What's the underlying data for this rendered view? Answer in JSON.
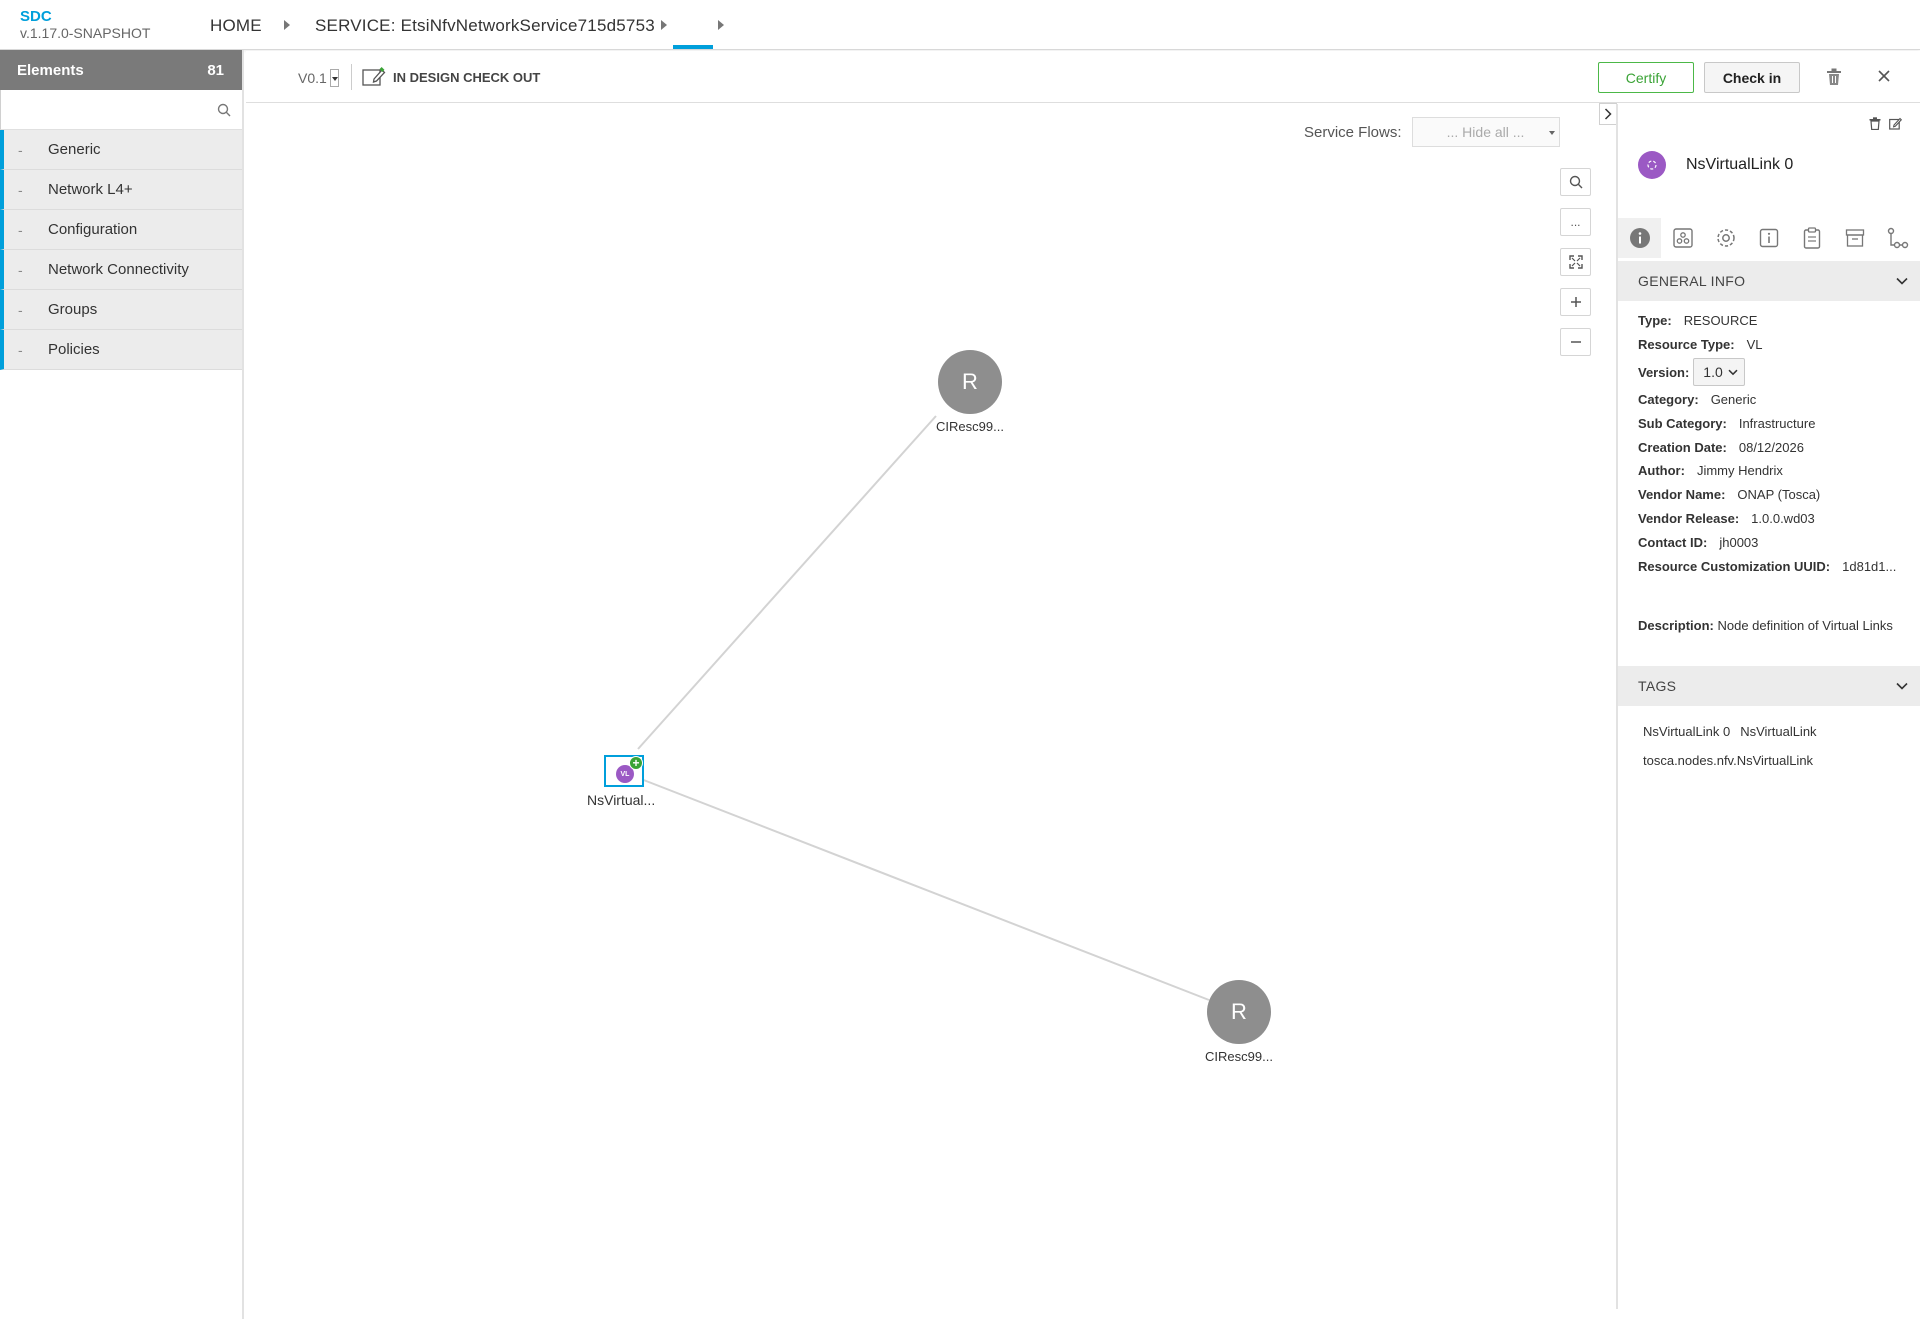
{
  "app": {
    "name": "SDC",
    "version": "v.1.17.0-SNAPSHOT"
  },
  "breadcrumb": {
    "home": "HOME",
    "service": "SERVICE: EtsiNfvNetworkService715d5753"
  },
  "palette": {
    "title": "Elements",
    "count": "81",
    "search_placeholder": "",
    "items": [
      {
        "dash": "-",
        "label": "Generic"
      },
      {
        "dash": "-",
        "label": "Network L4+"
      },
      {
        "dash": "-",
        "label": "Configuration"
      },
      {
        "dash": "-",
        "label": "Network Connectivity"
      },
      {
        "dash": "-",
        "label": "Groups"
      },
      {
        "dash": "-",
        "label": "Policies"
      }
    ]
  },
  "toolbar": {
    "version": "V0.1",
    "state": "IN DESIGN CHECK OUT",
    "certify_label": "Certify",
    "checkin_label": "Check in"
  },
  "canvas": {
    "service_flows_label": "Service Flows:",
    "service_flows_value": "... Hide all ...",
    "zoom_more": "...",
    "nodes": [
      {
        "letter": "R",
        "label": "CIResc99..."
      },
      {
        "letter": "R",
        "label": "CIResc99..."
      }
    ],
    "vl_node": {
      "badge": "VL",
      "label": "NsVirtual..."
    }
  },
  "right_panel": {
    "title": "NsVirtualLink 0",
    "accent_color": "#9b59c4",
    "general_info_title": "GENERAL INFO",
    "info": [
      {
        "label": "Type:",
        "value": "RESOURCE"
      },
      {
        "label": "Resource Type:",
        "value": "VL"
      },
      {
        "label": "Version:",
        "value": "1.0"
      },
      {
        "label": "Category:",
        "value": "Generic"
      },
      {
        "label": "Sub Category:",
        "value": "Infrastructure"
      },
      {
        "label": "Creation Date:",
        "value": "08/12/2026"
      },
      {
        "label": "Author:",
        "value": "Jimmy Hendrix"
      },
      {
        "label": "Vendor Name:",
        "value": "ONAP (Tosca)"
      },
      {
        "label": "Vendor Release:",
        "value": "1.0.0.wd03"
      },
      {
        "label": "Contact ID:",
        "value": "jh0003"
      },
      {
        "label": "Resource Customization UUID:",
        "value": "1d81d1..."
      }
    ],
    "description_label": "Description:",
    "description": "Node definition of Virtual Links",
    "tags_title": "TAGS",
    "tags": [
      "NsVirtualLink 0",
      "NsVirtualLink",
      "tosca.nodes.nfv.NsVirtualLink"
    ]
  },
  "icons": {
    "search": "search-icon",
    "trash": "trash-icon",
    "close": "close-icon",
    "info_tab": "info-icon",
    "deployment_tab": "deployment-icon",
    "properties_tab": "gear-icon"
  }
}
